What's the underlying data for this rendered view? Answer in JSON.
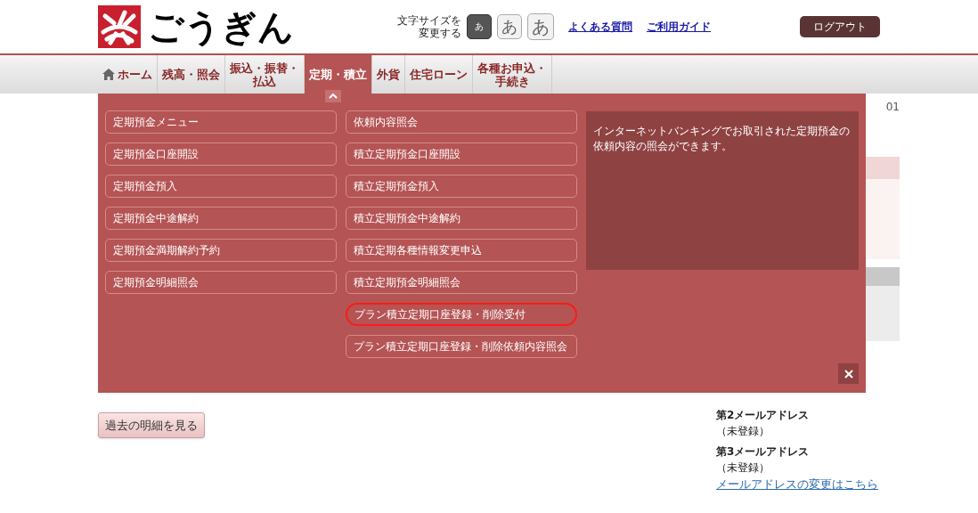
{
  "header": {
    "logo_text": "ごうぎん",
    "font_size_label": [
      "文字サイズを",
      "変更する"
    ],
    "font_sizes": [
      {
        "label": "あ",
        "selected": true
      },
      {
        "label": "あ",
        "selected": false
      },
      {
        "label": "あ",
        "selected": false
      }
    ],
    "links": [
      "よくある質問",
      "ご利用ガイド"
    ],
    "logout": "ログアウト"
  },
  "nav": [
    {
      "label": [
        "ホーム"
      ],
      "kind": "home",
      "selected": false
    },
    {
      "label": [
        "残高・照会"
      ],
      "kind": "text",
      "selected": false
    },
    {
      "label": [
        "振込・振替・",
        "払込"
      ],
      "kind": "text",
      "selected": false
    },
    {
      "label": [
        "定期・積立"
      ],
      "kind": "text",
      "selected": true
    },
    {
      "label": [
        "外貨"
      ],
      "kind": "text",
      "selected": false
    },
    {
      "label": [
        "住宅ローン"
      ],
      "kind": "text",
      "selected": false
    },
    {
      "label": [
        "各種お申込・",
        "手続き"
      ],
      "kind": "text",
      "selected": false
    }
  ],
  "dropdown": {
    "columns": [
      [
        {
          "label": "定期預金メニュー",
          "highlighted": false
        },
        {
          "label": "定期預金口座開設",
          "highlighted": false
        },
        {
          "label": "定期預金預入",
          "highlighted": false
        },
        {
          "label": "定期預金中途解約",
          "highlighted": false
        },
        {
          "label": "定期預金満期解約予約",
          "highlighted": false
        },
        {
          "label": "定期預金明細照会",
          "highlighted": false
        }
      ],
      [
        {
          "label": "依頼内容照会",
          "highlighted": false
        },
        {
          "label": "積立定期預金口座開設",
          "highlighted": false
        },
        {
          "label": "積立定期預金預入",
          "highlighted": false
        },
        {
          "label": "積立定期預金中途解約",
          "highlighted": false
        },
        {
          "label": "積立定期各種情報変更申込",
          "highlighted": false
        },
        {
          "label": "積立定期預金明細照会",
          "highlighted": false
        },
        {
          "label": "プラン積立定期口座登録・削除受付",
          "highlighted": true
        },
        {
          "label": "プラン積立定期口座登録・削除依頼内容照会",
          "highlighted": false
        }
      ]
    ],
    "description": "インターネットバンキングでお取引された定期預金の依頼内容の照会ができます。"
  },
  "page": {
    "partial_text": "01",
    "history_button": "過去の明細を見る",
    "emails": [
      {
        "heading": "第2メールアドレス",
        "value": "（未登録）"
      },
      {
        "heading": "第3メールアドレス",
        "value": "（未登録）"
      }
    ],
    "change_link": "メールアドレスの変更はこちら"
  }
}
